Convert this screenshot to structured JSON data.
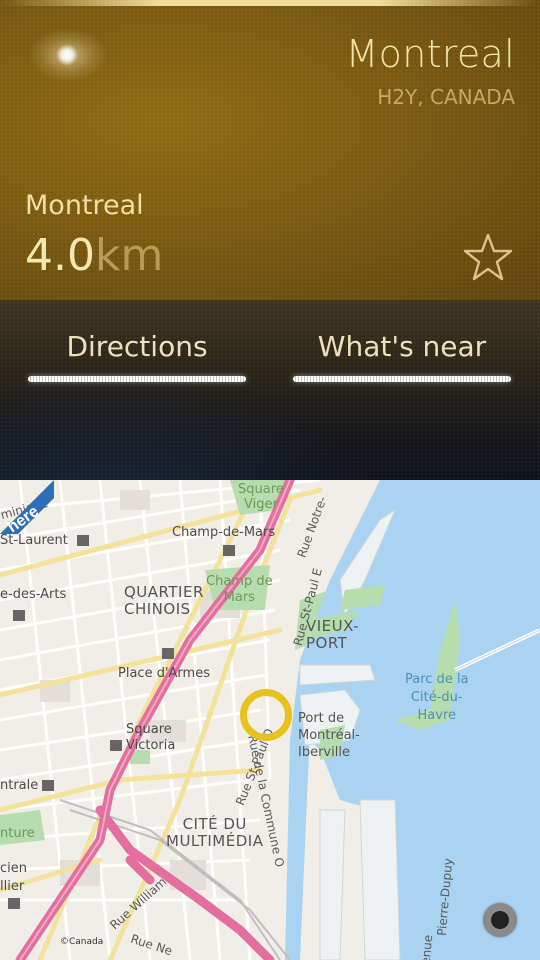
{
  "header": {
    "city": "Montreal",
    "region": "H2Y, CANADA",
    "place_name": "Montreal",
    "distance_value": "4.0",
    "distance_unit": "km",
    "favorite_icon": "star-outline-icon"
  },
  "actions": {
    "directions_label": "Directions",
    "whats_near_label": "What's near"
  },
  "map": {
    "labels": {
      "square_viger": "Square\nViger",
      "champ_de_mars": "Champ-de-Mars",
      "st_laurent": "St-Laurent",
      "des_arts": "e-des-Arts",
      "quartier_chinois": "QUARTIER\nCHINOIS",
      "champ_de_mars_park": "Champ de\nMars",
      "rue_st_paul_e": "Rue St-Paul E",
      "rue_notre": "Rue Notre-",
      "vieux_port": "VIEUX-\nPORT",
      "place_d_armes": "Place d'Armes",
      "parc_cite_havre": "Parc de la\nCité-du-\nHavre",
      "square_victoria": "Square\nVictoria",
      "port_de_montreal": "Port de\nMontréal-\nIberville",
      "rue_st_paul_o": "Rue St-Paul O",
      "rue_de_la_commune": "Rue de la Commune O",
      "ntrale": "ntrale",
      "cite_multimedia": "CITÉ DU\nMULTIMÉDIA",
      "nture": "nture",
      "cien_llier": "cien\nllier",
      "rue_william": "Rue William",
      "rue_ne": "Rue Ne",
      "pierre_dupuy": "Pierre-Dupuy",
      "avenue": "Avenue",
      "minique": "minique"
    },
    "logo": "here",
    "copyright": "©Canada",
    "locate_icon": "my-location-icon",
    "water_color": "#a9d3f0",
    "park_color": "#b7dcae",
    "highway_color": "#e36e9f",
    "marker_color": "#e8c21a"
  }
}
